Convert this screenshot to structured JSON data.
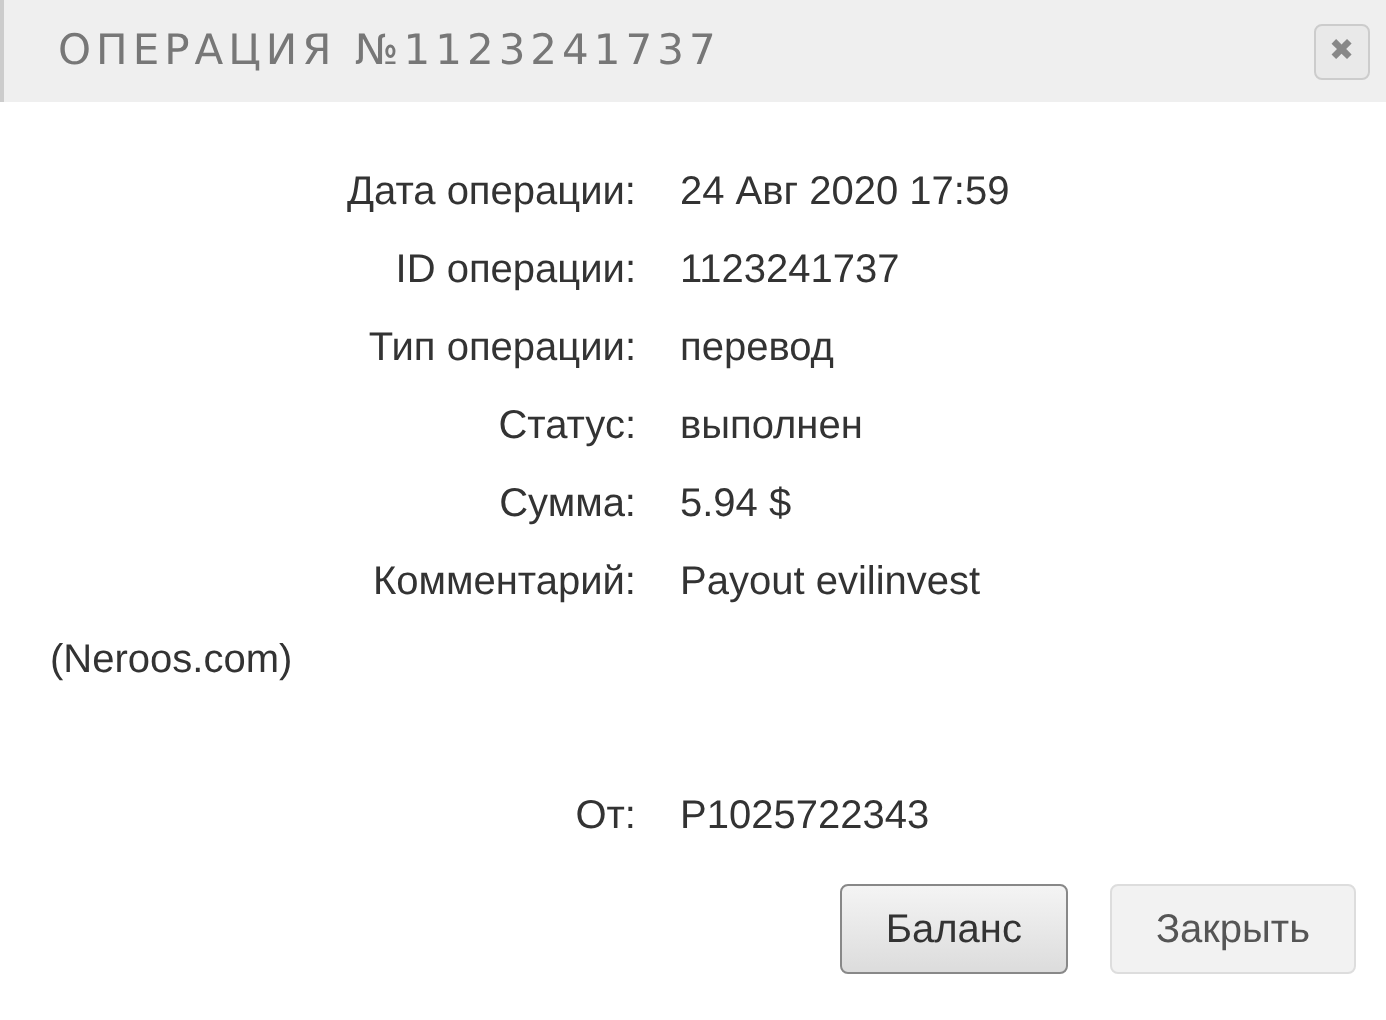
{
  "dialog": {
    "title": "ОПЕРАЦИЯ №1123241737",
    "close_icon": "✖"
  },
  "fields": [
    {
      "label": "Дата операции:",
      "value": "24 Авг 2020 17:59"
    },
    {
      "label": "ID операции:",
      "value": "1123241737"
    },
    {
      "label": "Тип операции:",
      "value": "перевод"
    },
    {
      "label": "Статус:",
      "value": "выполнен"
    },
    {
      "label": "Сумма:",
      "value": "5.94 $"
    },
    {
      "label": "Комментарий:",
      "value": "Payout evilinvest",
      "continuation": "(Neroos.com)"
    }
  ],
  "sender": {
    "label": "От:",
    "value": "P1025722343"
  },
  "buttons": [
    {
      "label": "Баланс",
      "kind": "primary"
    },
    {
      "label": "Закрыть",
      "kind": "secondary"
    }
  ]
}
